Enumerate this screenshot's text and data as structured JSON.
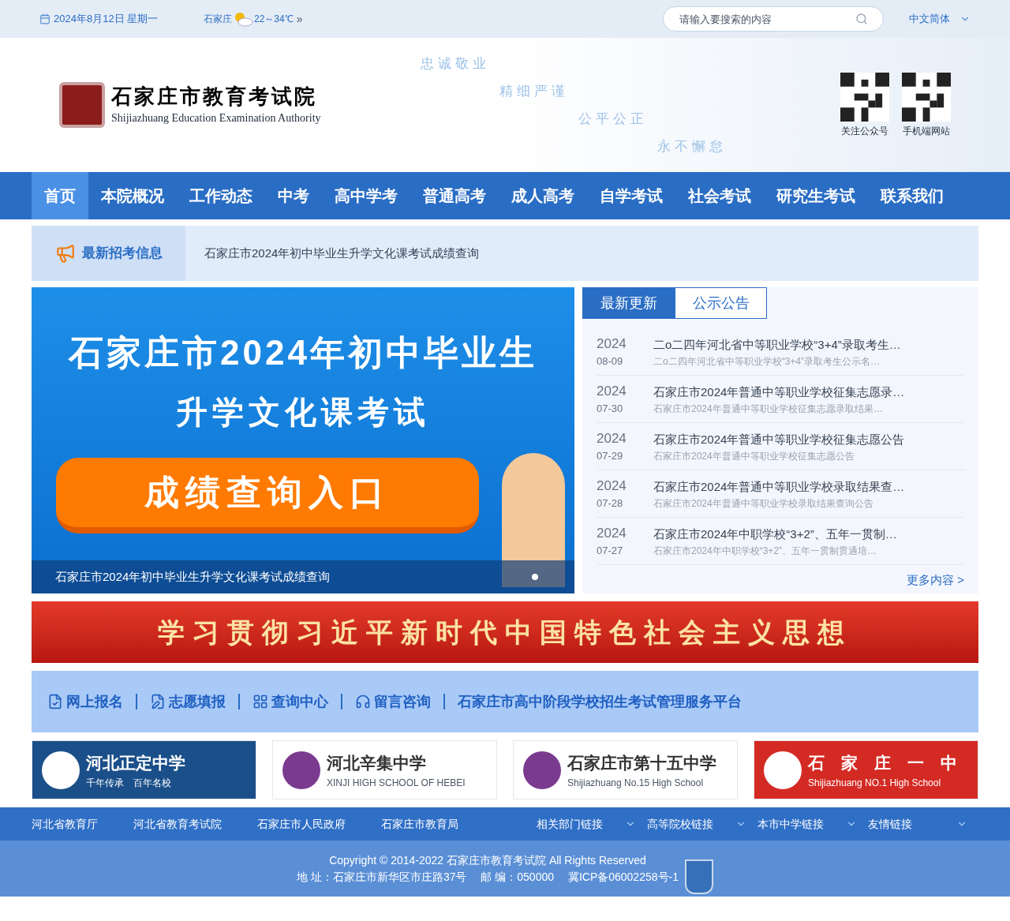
{
  "top_bar": {
    "date": "2024年8月12日 星期一",
    "weather": {
      "city": "石家庄",
      "temp": "22～34℃",
      "more": "»"
    },
    "search": {
      "placeholder": "请输入要搜索的内容"
    },
    "language": "中文简体"
  },
  "header": {
    "title": "石家庄市教育考试院",
    "subtitle": "Shijiazhuang Education Examination Authority",
    "mottos": [
      "忠诚敬业",
      "精细严谨",
      "公平公正",
      "永不懈怠"
    ],
    "qr_codes": [
      "关注公众号",
      "手机端网站"
    ]
  },
  "nav": [
    {
      "label": "首页",
      "selected": true
    },
    {
      "label": "本院概况",
      "selected": false
    },
    {
      "label": "工作动态",
      "selected": false
    },
    {
      "label": "中考",
      "selected": false
    },
    {
      "label": "高中学考",
      "selected": false
    },
    {
      "label": "普通高考",
      "selected": false
    },
    {
      "label": "成人高考",
      "selected": false
    },
    {
      "label": "自学考试",
      "selected": false
    },
    {
      "label": "社会考试",
      "selected": false
    },
    {
      "label": "研究生考试",
      "selected": false
    },
    {
      "label": "联系我们",
      "selected": false
    }
  ],
  "notice": {
    "label": "最新招考信息",
    "text": "石家庄市2024年初中毕业生升学文化课考试成绩查询"
  },
  "slide": {
    "heading_1": "石家庄市2024年初中毕业生",
    "heading_2": "升学文化课考试",
    "button": "成绩查询入口",
    "caption": "石家庄市2024年初中毕业生升学文化课考试成绩查询",
    "dots": [
      {
        "selected": true
      }
    ]
  },
  "news_tabs": [
    {
      "label": "最新更新",
      "selected": true
    },
    {
      "label": "公示公告",
      "selected": false
    }
  ],
  "news": [
    {
      "year": "2024",
      "date": "08-09",
      "title": "二o二四年河北省中等职业学校“3+4”录取考生…",
      "summary": "二o二四年河北省中等职业学校“3+4”录取考生公示名…"
    },
    {
      "year": "2024",
      "date": "07-30",
      "title": "石家庄市2024年普通中等职业学校征集志愿录…",
      "summary": "石家庄市2024年普通中等职业学校征集志愿录取结果…"
    },
    {
      "year": "2024",
      "date": "07-29",
      "title": "石家庄市2024年普通中等职业学校征集志愿公告",
      "summary": "石家庄市2024年普通中等职业学校征集志愿公告"
    },
    {
      "year": "2024",
      "date": "07-28",
      "title": "石家庄市2024年普通中等职业学校录取结果查…",
      "summary": "石家庄市2024年普通中等职业学校录取结果查询公告"
    },
    {
      "year": "2024",
      "date": "07-27",
      "title": "石家庄市2024年中职学校“3+2”、五年一贯制…",
      "summary": "石家庄市2024年中职学校“3+2”、五年一贯制贯通培…"
    }
  ],
  "more": "更多内容 >",
  "red_banner": "学习贯彻习近平新时代中国特色社会主义思想",
  "quick_links": [
    "网上报名",
    "志愿填报",
    "查询中心",
    "留言咨询",
    "石家庄市高中阶段学校招生考试管理服务平台"
  ],
  "schools": [
    {
      "name": "河北正定中学",
      "subtitle": "千年传承　百年名校",
      "color": "#1b4f8a"
    },
    {
      "name": "河北辛集中学",
      "subtitle": "XINJI HIGH SCHOOL OF HEBEI",
      "color": "#ffffff"
    },
    {
      "name": "石家庄市第十五中学",
      "subtitle": "Shijiazhuang No.15 High School",
      "color": "#ffffff"
    },
    {
      "name": "石　家　庄　一　中",
      "subtitle": "Shijiazhuang NO.1 High School",
      "color": "#d42a24"
    }
  ],
  "footer_links": [
    "河北省教育厅",
    "河北省教育考试院",
    "石家庄市人民政府",
    "石家庄市教育局"
  ],
  "footer_dropdowns": [
    "相关部门链接",
    "高等院校链接",
    "本市中学链接",
    "友情链接"
  ],
  "copyright": "Copyright © 2014-2022 石家庄市教育考试院 All Rights Reserved",
  "address": "地 址：石家庄市新华区市庄路37号　 邮 编：050000　 冀ICP备06002258号-1"
}
